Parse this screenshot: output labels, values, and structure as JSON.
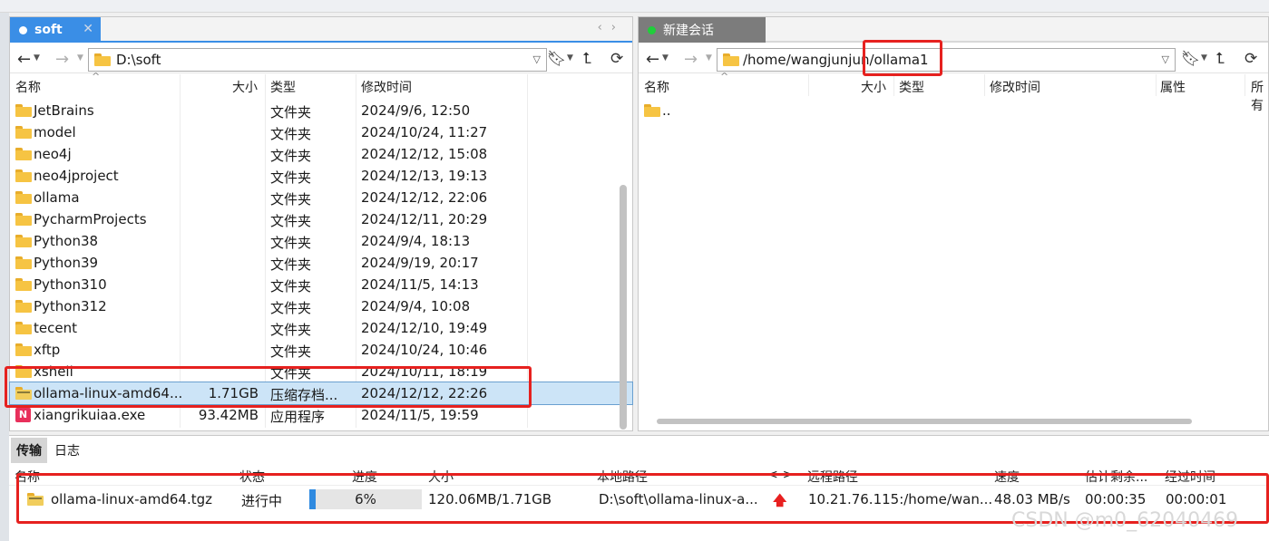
{
  "left_pane": {
    "tab_label": "soft",
    "path": "D:\\soft",
    "columns": {
      "name": "名称",
      "size": "大小",
      "type": "类型",
      "modified": "修改时间"
    },
    "rows": [
      {
        "name": "JetBrains",
        "size": "",
        "type": "文件夹",
        "modified": "2024/9/6, 12:50"
      },
      {
        "name": "model",
        "size": "",
        "type": "文件夹",
        "modified": "2024/10/24, 11:27"
      },
      {
        "name": "neo4j",
        "size": "",
        "type": "文件夹",
        "modified": "2024/12/12, 15:08"
      },
      {
        "name": "neo4jproject",
        "size": "",
        "type": "文件夹",
        "modified": "2024/12/13, 19:13"
      },
      {
        "name": "ollama",
        "size": "",
        "type": "文件夹",
        "modified": "2024/12/12, 22:06"
      },
      {
        "name": "PycharmProjects",
        "size": "",
        "type": "文件夹",
        "modified": "2024/12/11, 20:29"
      },
      {
        "name": "Python38",
        "size": "",
        "type": "文件夹",
        "modified": "2024/9/4, 18:13"
      },
      {
        "name": "Python39",
        "size": "",
        "type": "文件夹",
        "modified": "2024/9/19, 20:17"
      },
      {
        "name": "Python310",
        "size": "",
        "type": "文件夹",
        "modified": "2024/11/5, 14:13"
      },
      {
        "name": "Python312",
        "size": "",
        "type": "文件夹",
        "modified": "2024/9/4, 10:08"
      },
      {
        "name": "tecent",
        "size": "",
        "type": "文件夹",
        "modified": "2024/12/10, 19:49"
      },
      {
        "name": "xftp",
        "size": "",
        "type": "文件夹",
        "modified": "2024/10/24, 10:46"
      },
      {
        "name": "xshell",
        "size": "",
        "type": "文件夹",
        "modified": "2024/10/11, 18:19"
      },
      {
        "name": "ollama-linux-amd64...",
        "size": "1.71GB",
        "type": "压缩存档...",
        "modified": "2024/12/12, 22:26"
      },
      {
        "name": "xiangrikuiaa.exe",
        "size": "93.42MB",
        "type": "应用程序",
        "modified": "2024/11/5, 19:59"
      }
    ]
  },
  "right_pane": {
    "tab_label": "新建会话",
    "path_prefix": "/home/wangjunjun",
    "path_highlight": "/ollama1",
    "columns": {
      "name": "名称",
      "size": "大小",
      "type": "类型",
      "modified": "修改时间",
      "attr": "属性",
      "owner": "所有"
    },
    "rows": [
      {
        "name": ".."
      }
    ]
  },
  "bottom": {
    "tab_transfer": "传输",
    "tab_log": "日志",
    "columns": {
      "name": "名称",
      "status": "状态",
      "progress": "进度",
      "size": "大小",
      "local": "本地路径",
      "dir": "<->",
      "remote": "远程路径",
      "speed": "速度",
      "eta": "估计剩余...",
      "elapsed": "经过时间"
    },
    "transfer": {
      "name": "ollama-linux-amd64.tgz",
      "status": "进行中",
      "progress_label": "6%",
      "progress_value": 0.06,
      "size": "120.06MB/1.71GB",
      "local": "D:\\soft\\ollama-linux-a...",
      "remote": "10.21.76.115:/home/wan...",
      "speed": "48.03 MB/s",
      "eta": "00:00:35",
      "elapsed": "00:00:01"
    }
  },
  "watermark": "CSDN @m0_62040469",
  "colors": {
    "accent": "#3a8ee6",
    "annotation_red": "#e6211f",
    "selection": "#cce4f7"
  }
}
